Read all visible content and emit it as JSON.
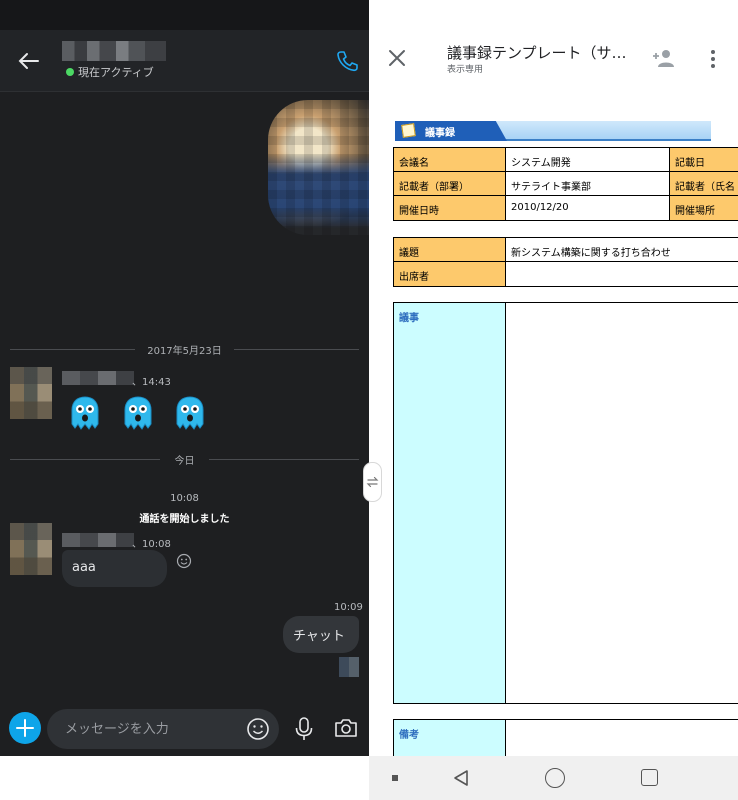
{
  "chat": {
    "status": "現在アクティブ",
    "date_separator_1": "2017年5月23日",
    "msg1_time": "、14:43",
    "date_separator_2": "今日",
    "call_time": "10:08",
    "call_text": "通話を開始しました",
    "msg2_time": "、10:08",
    "msg2_text": "aaa",
    "out_time": "10:09",
    "out_text": "チャット",
    "input_placeholder": "メッセージを入力"
  },
  "document": {
    "title": "議事録テンプレート（サ…",
    "subtitle": "表示専用",
    "sheet_tab": "議事録",
    "rows": {
      "meeting_name_label": "会議名",
      "meeting_name_value": "システム開発",
      "record_date_label": "記載日",
      "recorder_label": "記載者（部署）",
      "recorder_value": "サテライト事業部",
      "recorder_name_label": "記載者（氏名",
      "held_date_label": "開催日時",
      "held_date_value": "2010/12/20",
      "venue_label": "開催場所",
      "agenda_label": "議題",
      "agenda_value": "新システム構築に関する打ち合わせ",
      "attendees_label": "出席者",
      "proceedings_label": "議事",
      "notes_label": "備考"
    }
  },
  "colors": {
    "chat_bg": "#1e1f21",
    "accent_blue": "#0ea5e9",
    "active_green": "#4cd964",
    "header_cell": "#fdc96c",
    "cyan_cell": "#ccfdff"
  }
}
